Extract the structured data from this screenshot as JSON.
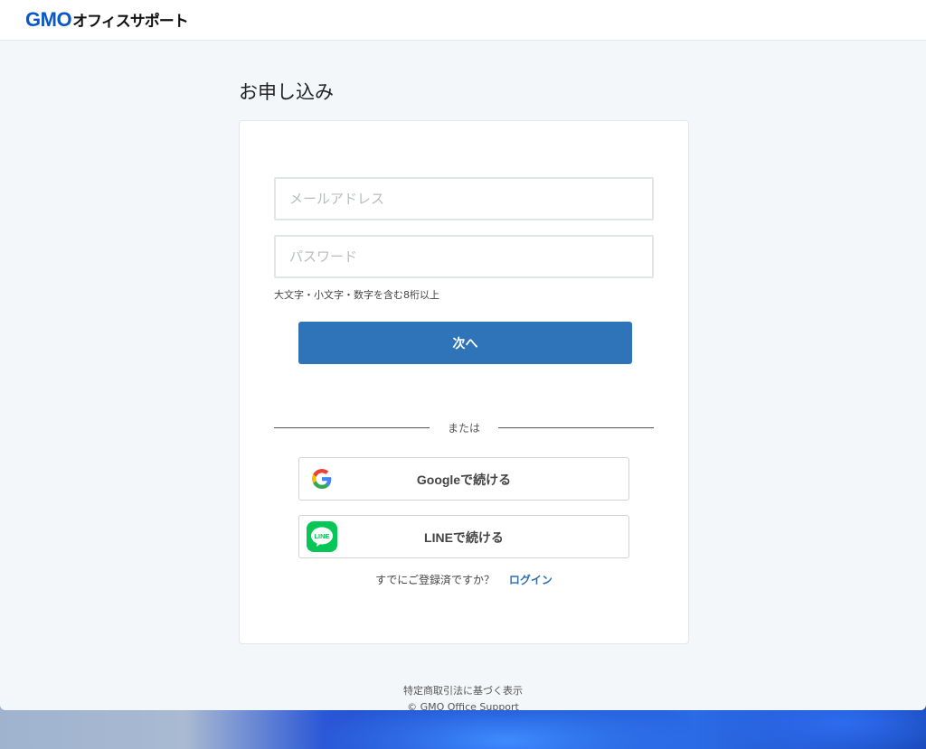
{
  "header": {
    "logo_main": "GMO",
    "logo_sub": "オフィスサポート"
  },
  "page": {
    "title": "お申し込み"
  },
  "form": {
    "email_placeholder": "メールアドレス",
    "email_value": "",
    "password_placeholder": "パスワード",
    "password_value": "",
    "password_hint": "大文字・小文字・数字を含む8桁以上",
    "next_label": "次へ",
    "or_label": "または",
    "google_label": "Googleで続ける",
    "line_label": "LINEで続ける",
    "line_icon_text": "LINE",
    "already_registered": "すでにご登録済ですか？",
    "login_label": "ログイン"
  },
  "footer": {
    "legal_link": "特定商取引法に基づく表示",
    "copyright": "© GMO Office Support"
  },
  "colors": {
    "brand_blue": "#0a58c7",
    "primary_button": "#2f74b9",
    "line_green": "#06c755",
    "link": "#2f6fb0"
  }
}
